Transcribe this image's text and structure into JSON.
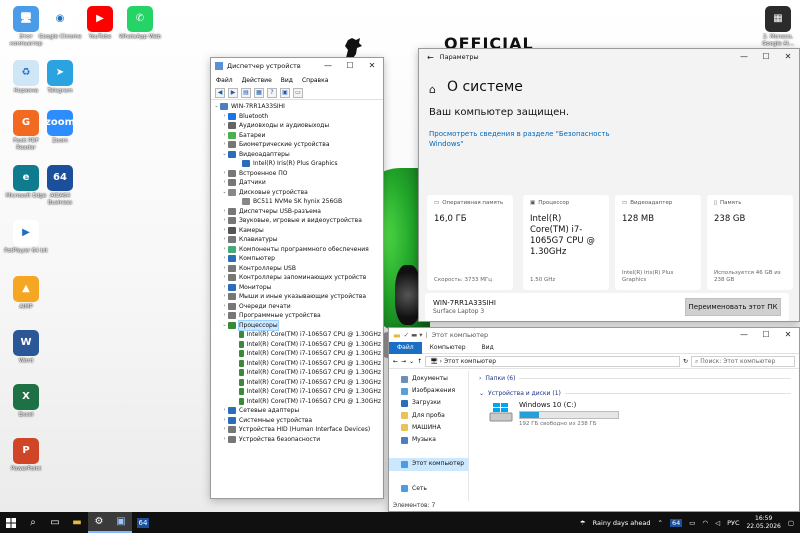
{
  "desktop": {
    "brand": "OFFICIAL",
    "icons": [
      {
        "label": "Этот компьютер",
        "color": "#4a9be8",
        "glyph": "🖥"
      },
      {
        "label": "Google Chrome",
        "color": "#ffffff",
        "glyph": "◉"
      },
      {
        "label": "YouTube",
        "color": "#ff0000",
        "glyph": "▶"
      },
      {
        "label": "WhatsApp Web",
        "color": "#25d366",
        "glyph": "✆"
      },
      {
        "label": "Корзина",
        "color": "#cfe6f7",
        "glyph": "♻"
      },
      {
        "label": "Telegram",
        "color": "#2aa3e0",
        "glyph": "➤"
      },
      {
        "label": "Foxit PDF Reader",
        "color": "#f26a21",
        "glyph": "G"
      },
      {
        "label": "Zoom",
        "color": "#2d8cff",
        "glyph": "zoom"
      },
      {
        "label": "Microsoft Edge",
        "color": "#0f7b8f",
        "glyph": "e"
      },
      {
        "label": "AIDA64 Business",
        "color": "#1b4f9c",
        "glyph": "64"
      },
      {
        "label": "PotPlayer 64 bit",
        "color": "#ffffff",
        "glyph": "▶"
      },
      {
        "label": "AIMP",
        "color": "#f5a623",
        "glyph": "▲"
      },
      {
        "label": "Word",
        "color": "#2b5797",
        "glyph": "W"
      },
      {
        "label": "Excel",
        "color": "#1e7145",
        "glyph": "X"
      },
      {
        "label": "PowerPoint",
        "color": "#d04525",
        "glyph": "P"
      }
    ],
    "right_icon": {
      "label": "2. Monaco, Google Al..."
    }
  },
  "devmgr": {
    "title": "Диспетчер устройств",
    "menu": [
      "Файл",
      "Действие",
      "Вид",
      "Справка"
    ],
    "root": "WIN-7RR1A33SIHI",
    "nodes": [
      {
        "label": "Bluetooth",
        "level": 1,
        "exp": "›",
        "color": "#1a73e8"
      },
      {
        "label": "Аудиовходы и аудиовыходы",
        "level": 1,
        "exp": "›",
        "color": "#666"
      },
      {
        "label": "Батареи",
        "level": 1,
        "exp": "›",
        "color": "#4caf50"
      },
      {
        "label": "Биометрические устройства",
        "level": 1,
        "exp": "›",
        "color": "#777"
      },
      {
        "label": "Видеоадаптеры",
        "level": 1,
        "exp": "⌄",
        "color": "#2a6ebb"
      },
      {
        "label": "Intel(R) Iris(R) Plus Graphics",
        "level": 2,
        "exp": "",
        "color": "#2a6ebb"
      },
      {
        "label": "Встроенное ПО",
        "level": 1,
        "exp": "›",
        "color": "#777"
      },
      {
        "label": "Датчики",
        "level": 1,
        "exp": "›",
        "color": "#777"
      },
      {
        "label": "Дисковые устройства",
        "level": 1,
        "exp": "⌄",
        "color": "#888"
      },
      {
        "label": "BC511 NVMe SK hynix 256GB",
        "level": 2,
        "exp": "",
        "color": "#888"
      },
      {
        "label": "Диспетчеры USB-разъема",
        "level": 1,
        "exp": "›",
        "color": "#777"
      },
      {
        "label": "Звуковые, игровые и видеоустройства",
        "level": 1,
        "exp": "›",
        "color": "#777"
      },
      {
        "label": "Камеры",
        "level": 1,
        "exp": "›",
        "color": "#555"
      },
      {
        "label": "Клавиатуры",
        "level": 1,
        "exp": "›",
        "color": "#777"
      },
      {
        "label": "Компоненты программного обеспечения",
        "level": 1,
        "exp": "›",
        "color": "#4a7"
      },
      {
        "label": "Компьютер",
        "level": 1,
        "exp": "›",
        "color": "#2a6ebb"
      },
      {
        "label": "Контроллеры USB",
        "level": 1,
        "exp": "›",
        "color": "#777"
      },
      {
        "label": "Контроллеры запоминающих устройств",
        "level": 1,
        "exp": "›",
        "color": "#777"
      },
      {
        "label": "Мониторы",
        "level": 1,
        "exp": "›",
        "color": "#2a6ebb"
      },
      {
        "label": "Мыши и иные указывающие устройства",
        "level": 1,
        "exp": "›",
        "color": "#777"
      },
      {
        "label": "Очереди печати",
        "level": 1,
        "exp": "›",
        "color": "#777"
      },
      {
        "label": "Программные устройства",
        "level": 1,
        "exp": "›",
        "color": "#777"
      },
      {
        "label": "Процессоры",
        "level": 1,
        "exp": "⌄",
        "color": "#3a8a3a",
        "selected": true
      },
      {
        "label": "Intel(R) Core(TM) i7-1065G7 CPU @ 1.30GHz",
        "level": 2,
        "exp": "",
        "color": "#3a8a3a"
      },
      {
        "label": "Intel(R) Core(TM) i7-1065G7 CPU @ 1.30GHz",
        "level": 2,
        "exp": "",
        "color": "#3a8a3a"
      },
      {
        "label": "Intel(R) Core(TM) i7-1065G7 CPU @ 1.30GHz",
        "level": 2,
        "exp": "",
        "color": "#3a8a3a"
      },
      {
        "label": "Intel(R) Core(TM) i7-1065G7 CPU @ 1.30GHz",
        "level": 2,
        "exp": "",
        "color": "#3a8a3a"
      },
      {
        "label": "Intel(R) Core(TM) i7-1065G7 CPU @ 1.30GHz",
        "level": 2,
        "exp": "",
        "color": "#3a8a3a"
      },
      {
        "label": "Intel(R) Core(TM) i7-1065G7 CPU @ 1.30GHz",
        "level": 2,
        "exp": "",
        "color": "#3a8a3a"
      },
      {
        "label": "Intel(R) Core(TM) i7-1065G7 CPU @ 1.30GHz",
        "level": 2,
        "exp": "",
        "color": "#3a8a3a"
      },
      {
        "label": "Intel(R) Core(TM) i7-1065G7 CPU @ 1.30GHz",
        "level": 2,
        "exp": "",
        "color": "#3a8a3a"
      },
      {
        "label": "Сетевые адаптеры",
        "level": 1,
        "exp": "›",
        "color": "#2a6ebb"
      },
      {
        "label": "Системные устройства",
        "level": 1,
        "exp": "›",
        "color": "#2a6ebb"
      },
      {
        "label": "Устройства HID (Human Interface Devices)",
        "level": 1,
        "exp": "›",
        "color": "#777"
      },
      {
        "label": "Устройства безопасности",
        "level": 1,
        "exp": "›",
        "color": "#777"
      }
    ]
  },
  "settings": {
    "app_title": "Параметры",
    "page_title": "О системе",
    "protected": "Ваш компьютер защищен.",
    "link": "Просмотреть сведения в разделе \"Безопасность Windows\"",
    "cards": [
      {
        "header": "Оперативная память",
        "value": "16,0 ГБ",
        "sub": "Скорость: 3733 МГц"
      },
      {
        "header": "Процессор",
        "value": "Intel(R) Core(TM) i7-1065G7 CPU @ 1.30GHz",
        "sub": "1.50 GHz"
      },
      {
        "header": "Видеоадаптер",
        "value": "128 MB",
        "sub": "Intel(R) Iris(R) Plus Graphics"
      },
      {
        "header": "Память",
        "value": "238 GB",
        "sub": "Используется 46 GB из 238 GB"
      }
    ],
    "pc_name": "WIN-7RR1A33SIHI",
    "pc_model": "Surface Laptop 3",
    "rename_button": "Переименовать этот ПК"
  },
  "explorer": {
    "title": "Этот компьютер",
    "ribbon": [
      "Файл",
      "Компьютер",
      "Вид"
    ],
    "address": "Этот компьютер",
    "search_placeholder": "Поиск: Этот компьютер",
    "nav": [
      {
        "label": "Документы",
        "color": "#6d8fb5"
      },
      {
        "label": "Изображения",
        "color": "#5aa0d8"
      },
      {
        "label": "Загрузки",
        "color": "#2a6ebb"
      },
      {
        "label": "Для проба",
        "color": "#e8c35a"
      },
      {
        "label": "МАШИНА",
        "color": "#e8c35a"
      },
      {
        "label": "Музыка",
        "color": "#4a7fc1"
      },
      {
        "label": "",
        "color": "#ffffff"
      },
      {
        "label": "Этот компьютер",
        "color": "#4a9be8",
        "selected": true
      },
      {
        "label": "",
        "color": "#ffffff"
      },
      {
        "label": "Сеть",
        "color": "#4a9be8"
      }
    ],
    "group_folders": "Папки (6)",
    "group_drives": "Устройства и диски (1)",
    "drive_name": "Windows 10 (C:)",
    "drive_free": "192 ГБ свободно из 238 ГБ",
    "drive_used_fraction": 0.19,
    "status": "Элементов: 7"
  },
  "taskbar": {
    "weather": "Rainy days ahead",
    "lang": "РУС",
    "time": "16:59",
    "date": "22.05.2026",
    "aida": "64"
  }
}
